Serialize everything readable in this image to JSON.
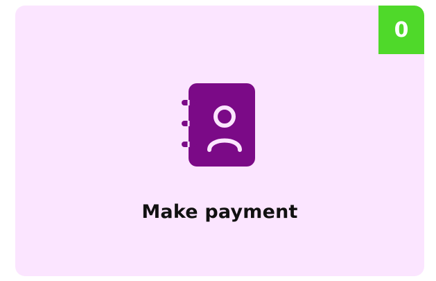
{
  "card": {
    "label": "Make payment",
    "badge_count": "0",
    "icon": "contact-book-icon",
    "colors": {
      "background": "#fbe5ff",
      "badge": "#4fd92a",
      "icon": "#7b0a87",
      "label": "#111111"
    }
  }
}
